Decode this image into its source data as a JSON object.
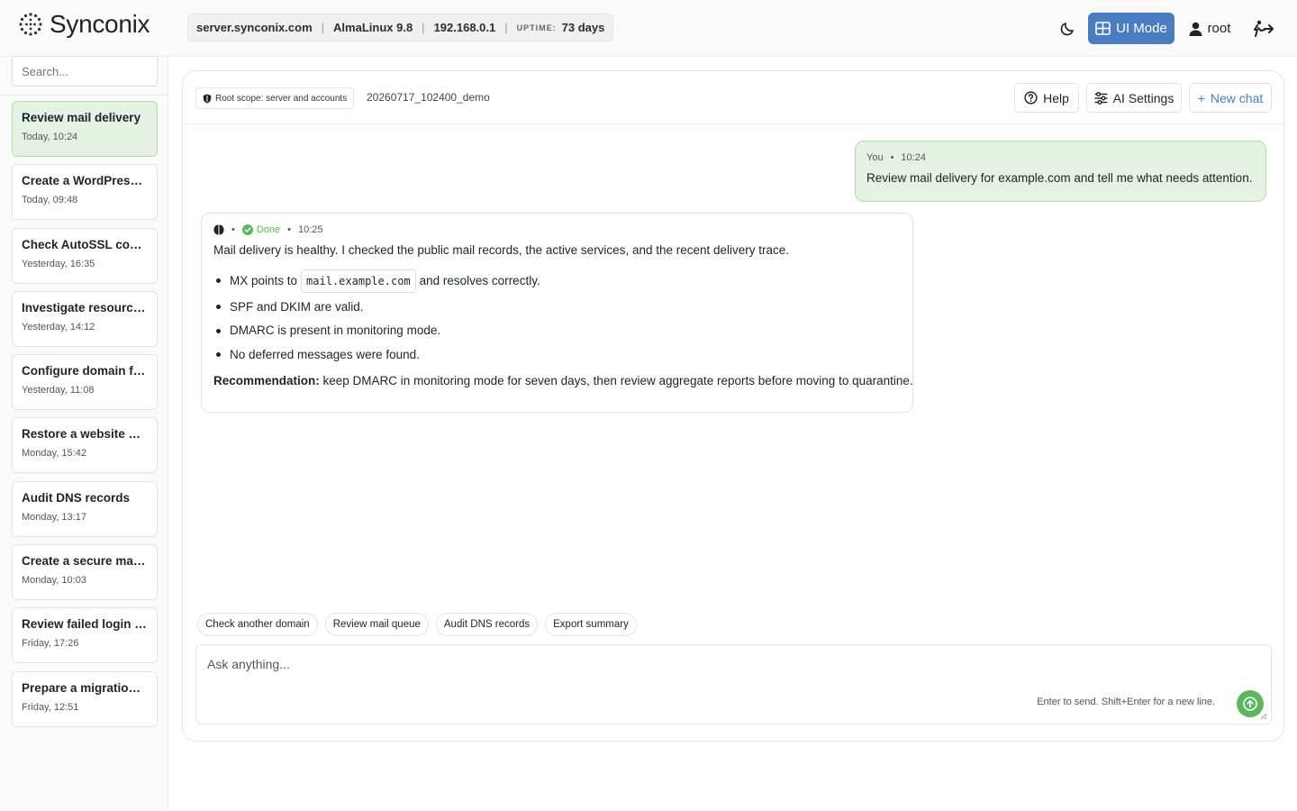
{
  "app": {
    "name": "Synconix"
  },
  "header": {
    "hostname": "server.synconix.com",
    "os": "AlmaLinux 9.8",
    "ip": "192.168.0.1",
    "uptime_label": "UPTIME:",
    "uptime_value": "73 days",
    "ui_mode_label": "UI Mode",
    "user_label": "root"
  },
  "sidebar": {
    "search_placeholder": "Search...",
    "chats": [
      {
        "title": "Review mail delivery",
        "time": "Today, 10:24"
      },
      {
        "title": "Create a WordPress site",
        "time": "Today, 09:48"
      },
      {
        "title": "Check AutoSSL coverage",
        "time": "Yesterday, 16:35"
      },
      {
        "title": "Investigate resource usage",
        "time": "Yesterday, 14:12"
      },
      {
        "title": "Configure domain forwarding",
        "time": "Yesterday, 11:08"
      },
      {
        "title": "Restore a website backup",
        "time": "Monday, 15:42"
      },
      {
        "title": "Audit DNS records",
        "time": "Monday, 13:17"
      },
      {
        "title": "Create a secure mailbox",
        "time": "Monday, 10:03"
      },
      {
        "title": "Review failed login attempts",
        "time": "Friday, 17:26"
      },
      {
        "title": "Prepare a migration plan",
        "time": "Friday, 12:51"
      }
    ]
  },
  "panel": {
    "scope_label": "Root scope: server and accounts",
    "session_id": "20260717_102400_demo",
    "help_label": "Help",
    "ai_settings_label": "AI Settings",
    "new_chat_label": "New chat",
    "new_chat_prefix": "+"
  },
  "messages": {
    "user": {
      "author": "You",
      "separator": "•",
      "time": "10:24",
      "text": "Review mail delivery for example.com and tell me what needs attention."
    },
    "ai": {
      "separator": "•",
      "status": "Done",
      "time": "10:25",
      "intro": "Mail delivery is healthy. I checked the public mail records, the active services, and the recent delivery trace.",
      "bullet1_prefix": "MX points to",
      "bullet1_code": "mail.example.com",
      "bullet1_suffix": "and resolves correctly.",
      "bullet2": "SPF and DKIM are valid.",
      "bullet3": "DMARC is present in monitoring mode.",
      "bullet4": "No deferred messages were found.",
      "rec_label": "Recommendation:",
      "rec_text": "keep DMARC in monitoring mode for seven days, then review aggregate reports before moving to quarantine."
    }
  },
  "suggestions": [
    "Check another domain",
    "Review mail queue",
    "Audit DNS records",
    "Export summary"
  ],
  "composer": {
    "placeholder": "Ask anything...",
    "hint": "Enter to send. Shift+Enter for a new line."
  },
  "colors": {
    "accent_blue": "#4a7dbf",
    "accent_green": "#5cb85c",
    "user_bubble": "#e5f1e2"
  }
}
